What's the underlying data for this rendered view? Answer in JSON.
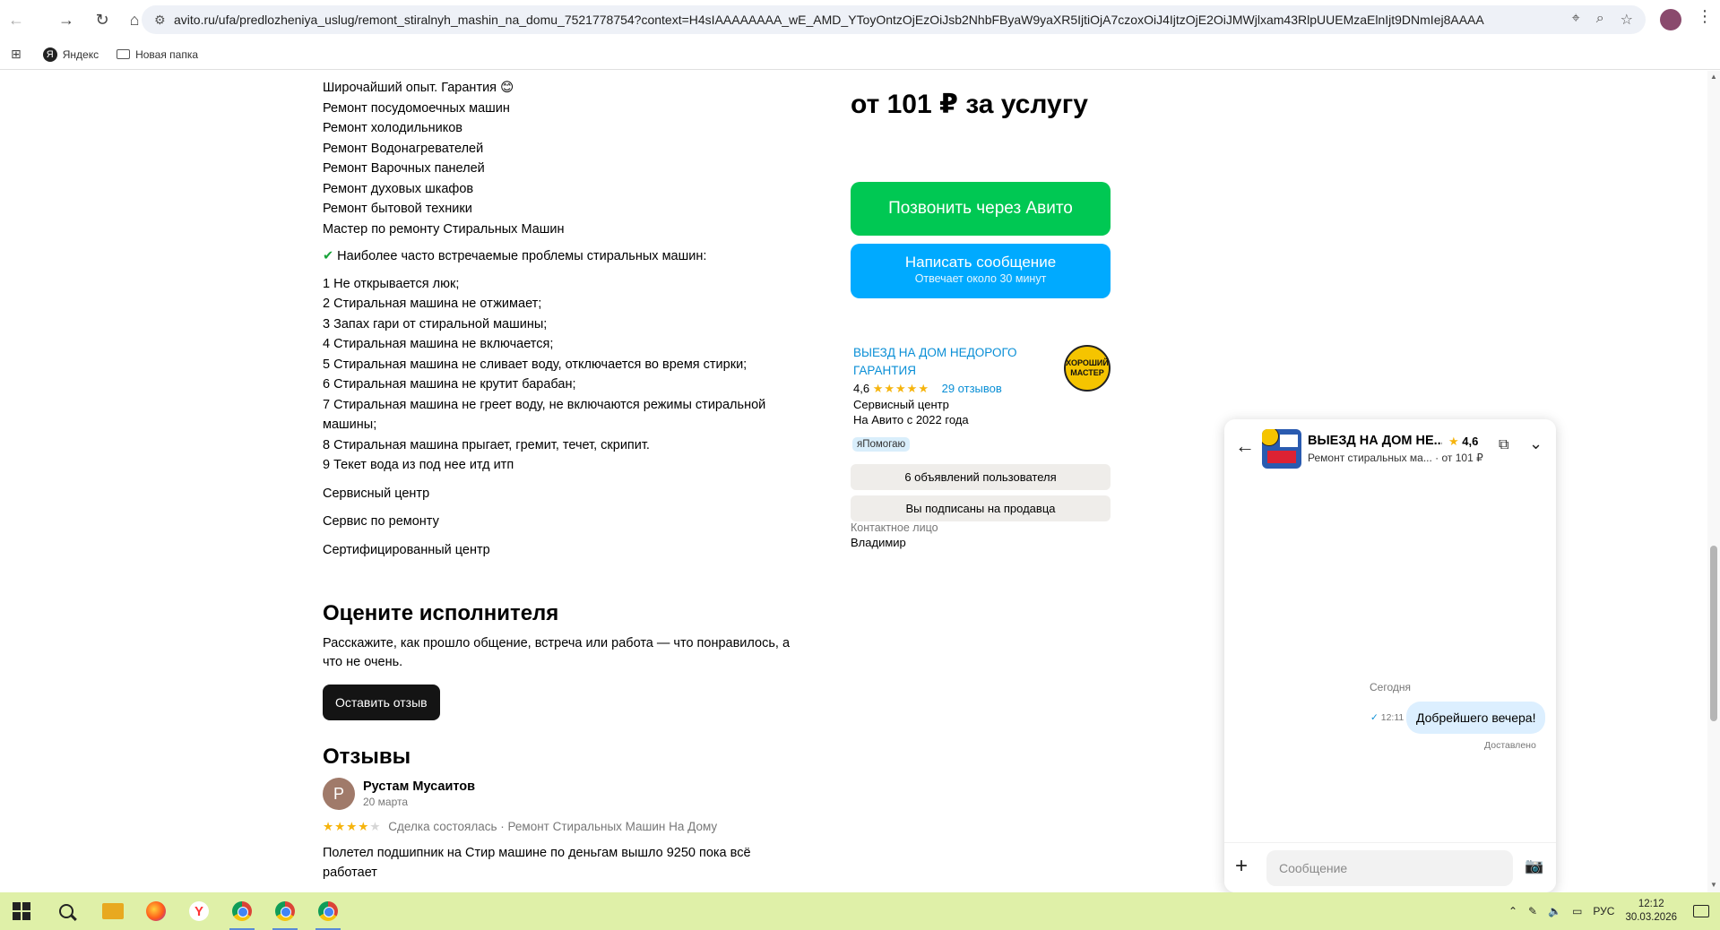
{
  "browser": {
    "url": "avito.ru/ufa/predlozheniya_uslug/remont_stiralnyh_mashin_na_domu_7521778754?context=H4sIAAAAAAAA_wE_AMD_YToyOntzOjEzOiJsb2NhbFByaW9yaXR5IjtiOjA7czoxOiJ4IjtzOjE2OiJMWjlxam43RlpUUEMzaElnIjt9DNmIej8AAAA",
    "bookmarks": [
      {
        "label": "Яндекс"
      },
      {
        "label": "Новая папка"
      }
    ]
  },
  "description": {
    "lines": [
      "Широчайший опыт. Гарантия 😊",
      "Ремонт посудомоечных машин",
      "Ремонт холодильников",
      "Ремонт Водонагревателей",
      "Ремонт Варочных панелей",
      "Ремонт духовых шкафов",
      "Ремонт бытовой техники",
      "Мастер по ремонту Стиральных Машин"
    ],
    "problems_title": "Наиболее часто встречаемые проблемы стиральных машин:",
    "problems": [
      "1 Не открывается люк;",
      "2 Стиральная машина не отжимает;",
      "3 Запах гари от стиральной машины;",
      "4 Стиральная машина не включается;",
      "5 Стиральная машина не сливает воду, отключается во время стирки;",
      "6 Стиральная машина не крутит барабан;",
      "7 Стиральная машина не греет воду, не включаются режимы стиральной машины;",
      "8 Стиральная машина прыгает, гремит, течет, скрипит.",
      "9 Текет вода из под нее итд итп"
    ],
    "services": [
      "Сервисный центр",
      "Сервис по ремонту",
      "Сертифицированный центр"
    ]
  },
  "rate": {
    "title": "Оцените исполнителя",
    "text": "Расскажите, как прошло общение, встреча или работа — что понравилось, а что не очень.",
    "button": "Оставить отзыв"
  },
  "reviews": {
    "title": "Отзывы",
    "items": [
      {
        "initial": "Р",
        "name": "Рустам Мусаитов",
        "date": "20 марта",
        "stars": 4,
        "meta": "Сделка состоялась · Ремонт Стиральных Машин На Дому",
        "text": "Полетел подшипник на Стир машине по деньгам вышло 9250 пока всё работает"
      }
    ]
  },
  "offer": {
    "price": "от 101 ₽ за услугу",
    "call_button": "Позвонить через Авито",
    "message_button": "Написать сообщение",
    "message_sub": "Отвечает около 30 минут"
  },
  "seller": {
    "name": "ВЫЕЗД НА ДОМ НЕДОРОГО ГАРАНТИЯ",
    "rating": "4,6",
    "stars": 4.6,
    "reviews_link": "29 отзывов",
    "type": "Сервисный центр",
    "since": "На Авито с 2022 года",
    "logo_text": "ХОРОШИЙ МАСТЕР",
    "badge": "яПомогаю",
    "ads_button": "6 объявлений пользователя",
    "subscribed_button": "Вы подписаны на продавца",
    "contact_label": "Контактное лицо",
    "contact_name": "Владимир"
  },
  "chat": {
    "title": "ВЫЕЗД НА ДОМ НЕ...",
    "rating": "4,6",
    "subtitle": "Ремонт стиральных ма...  · от 101 ₽",
    "day_label": "Сегодня",
    "messages": [
      {
        "text": "Добрейшего вечера!",
        "time": "12:11",
        "status": "Доставлено"
      }
    ],
    "input_placeholder": "Сообщение"
  },
  "taskbar": {
    "language": "РУС",
    "time": "12:12",
    "date": "30.03.2026"
  }
}
